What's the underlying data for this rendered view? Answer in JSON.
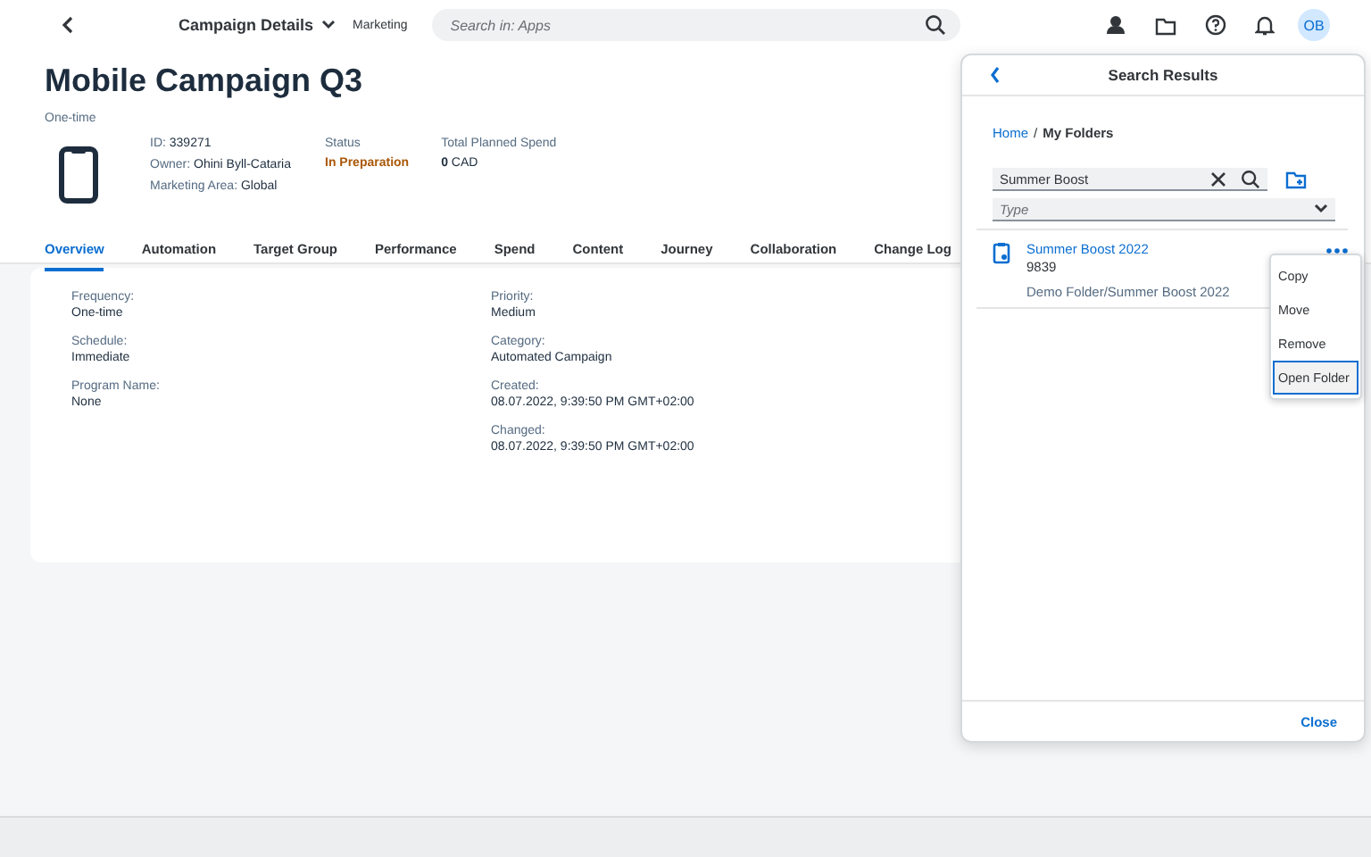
{
  "shell": {
    "app_title": "Campaign Details",
    "subtitle": "Marketing",
    "search_placeholder": "Search in: Apps",
    "avatar": "OB"
  },
  "header": {
    "title": "Mobile Campaign Q3",
    "type": "One-time",
    "id_label": "ID:",
    "id": "339271",
    "owner_label": "Owner:",
    "owner": "Ohini Byll-Cataria",
    "area_label": "Marketing Area:",
    "area": "Global",
    "status_label": "Status",
    "status": "In Preparation",
    "spend_label": "Total Planned Spend",
    "spend_amount": "0",
    "spend_currency": "CAD"
  },
  "tabs": [
    {
      "label": "Overview",
      "selected": true
    },
    {
      "label": "Automation",
      "selected": false
    },
    {
      "label": "Target Group",
      "selected": false
    },
    {
      "label": "Performance",
      "selected": false
    },
    {
      "label": "Spend",
      "selected": false
    },
    {
      "label": "Content",
      "selected": false
    },
    {
      "label": "Journey",
      "selected": false
    },
    {
      "label": "Collaboration",
      "selected": false
    },
    {
      "label": "Change Log",
      "selected": false
    }
  ],
  "fields_left": [
    {
      "label": "Frequency:",
      "value": "One-time"
    },
    {
      "label": "Schedule:",
      "value": "Immediate"
    },
    {
      "label": "Program Name:",
      "value": "None"
    }
  ],
  "fields_right": [
    {
      "label": "Priority:",
      "value": "Medium"
    },
    {
      "label": "Category:",
      "value": "Automated Campaign"
    },
    {
      "label": "Created:",
      "value": "08.07.2022, 9:39:50 PM GMT+02:00"
    },
    {
      "label": "Changed:",
      "value": "08.07.2022, 9:39:50 PM GMT+02:00"
    }
  ],
  "popover": {
    "title": "Search Results",
    "breadcrumb_link": "Home",
    "breadcrumb_separator": "/",
    "breadcrumb_current": "My Folders",
    "search_value": "Summer Boost",
    "type_placeholder": "Type",
    "result": {
      "name": "Summer Boost 2022",
      "id": "9839",
      "path": "Demo Folder/Summer Boost 2022"
    },
    "menu": [
      {
        "label": "Copy",
        "selected": false
      },
      {
        "label": "Move",
        "selected": false
      },
      {
        "label": "Remove",
        "selected": false
      },
      {
        "label": "Open Folder",
        "selected": true
      }
    ],
    "close": "Close"
  }
}
